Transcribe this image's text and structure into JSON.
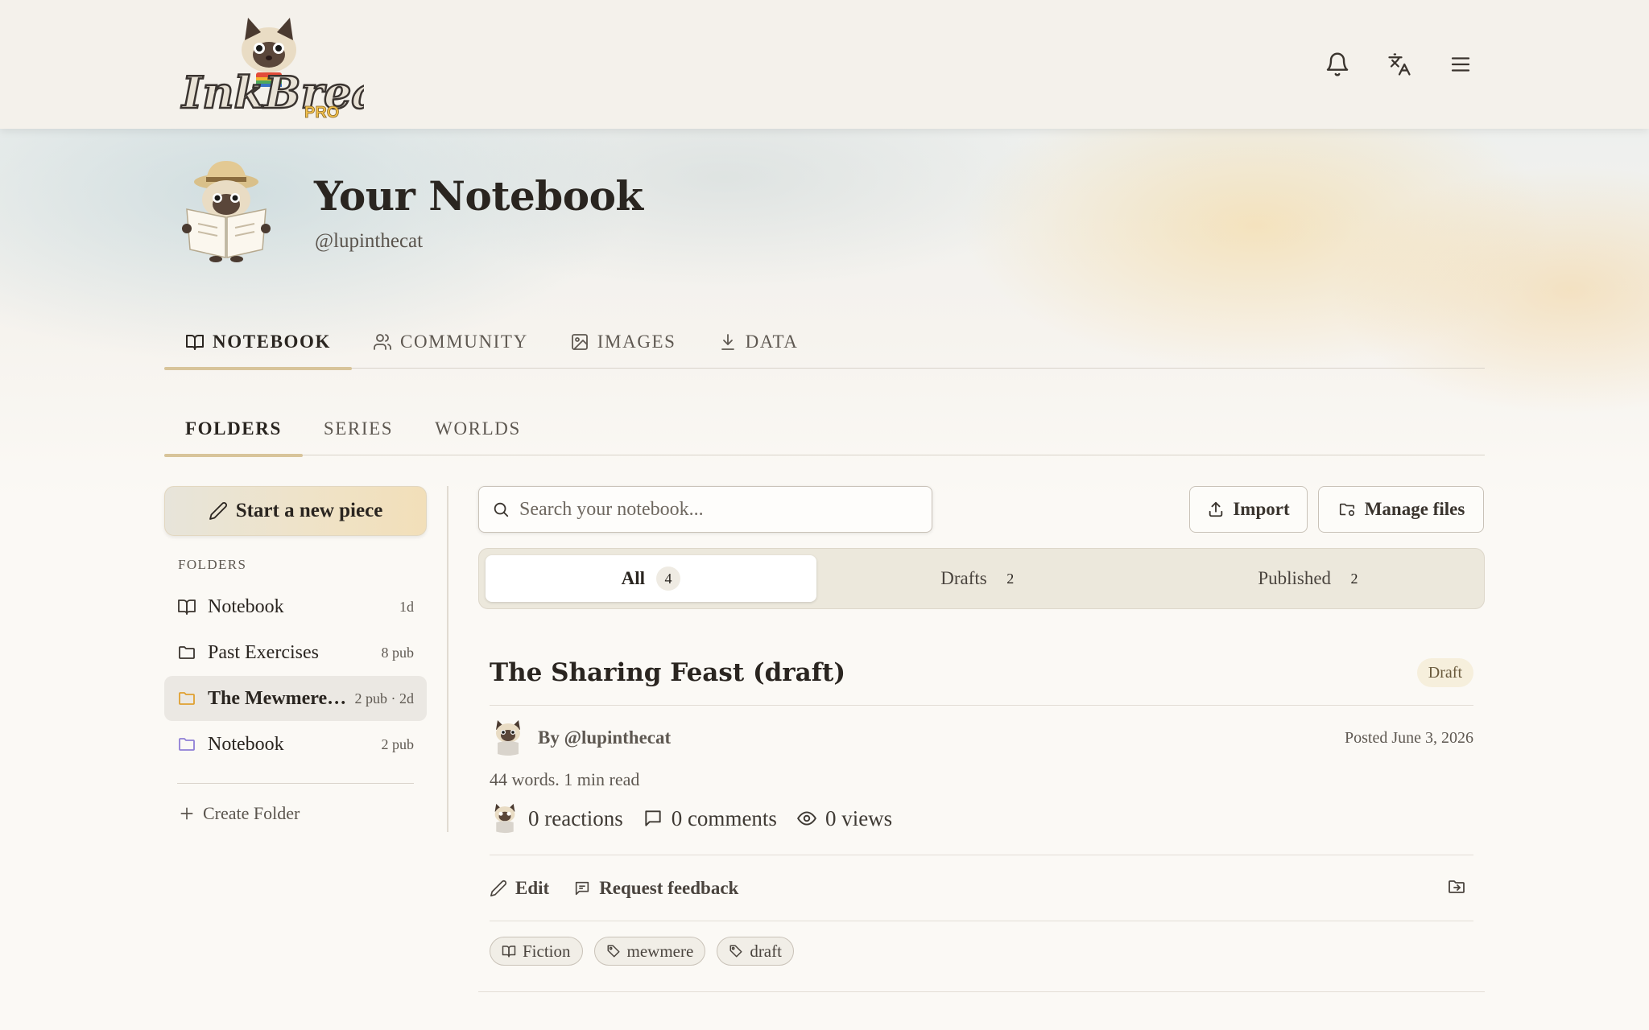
{
  "header": {
    "logo_text": "InkBreaker",
    "logo_sub": "PRO"
  },
  "profile": {
    "title": "Your Notebook",
    "handle": "@lupinthecat"
  },
  "main_tabs": [
    {
      "label": "NOTEBOOK",
      "icon": "book-icon"
    },
    {
      "label": "COMMUNITY",
      "icon": "users-icon"
    },
    {
      "label": "IMAGES",
      "icon": "image-icon"
    },
    {
      "label": "DATA",
      "icon": "download-icon"
    }
  ],
  "sub_tabs": [
    "FOLDERS",
    "SERIES",
    "WORLDS"
  ],
  "sidebar": {
    "new_piece": "Start a new piece",
    "folders_label": "FOLDERS",
    "folders": [
      {
        "name": "Notebook",
        "meta": "1d",
        "icon": "book-icon"
      },
      {
        "name": "Past Exercises",
        "meta": "8 pub",
        "icon": "folder-icon"
      },
      {
        "name": "The Mewmere Chronicles",
        "meta": "2 pub · 2d",
        "icon": "folder-icon",
        "color": "#e0a030"
      },
      {
        "name": "Notebook",
        "meta": "2 pub",
        "icon": "folder-icon",
        "color": "#8f7fd6"
      }
    ],
    "create_folder": "Create Folder"
  },
  "search": {
    "placeholder": "Search your notebook..."
  },
  "toolbar": {
    "import": "Import",
    "manage_files": "Manage files"
  },
  "filters": [
    {
      "label": "All",
      "count": "4"
    },
    {
      "label": "Drafts",
      "count": "2"
    },
    {
      "label": "Published",
      "count": "2"
    }
  ],
  "post": {
    "title": "The Sharing Feast (draft)",
    "badge": "Draft",
    "author": "By @lupinthecat",
    "posted": "Posted June 3, 2026",
    "stats": "44 words. 1 min read",
    "reactions": "0 reactions",
    "comments": "0 comments",
    "views": "0 views",
    "edit": "Edit",
    "request_feedback": "Request feedback",
    "tags": [
      "Fiction",
      "mewmere",
      "draft"
    ]
  },
  "colors": {
    "accent": "#d8c49a",
    "background": "#fbf9f5"
  }
}
